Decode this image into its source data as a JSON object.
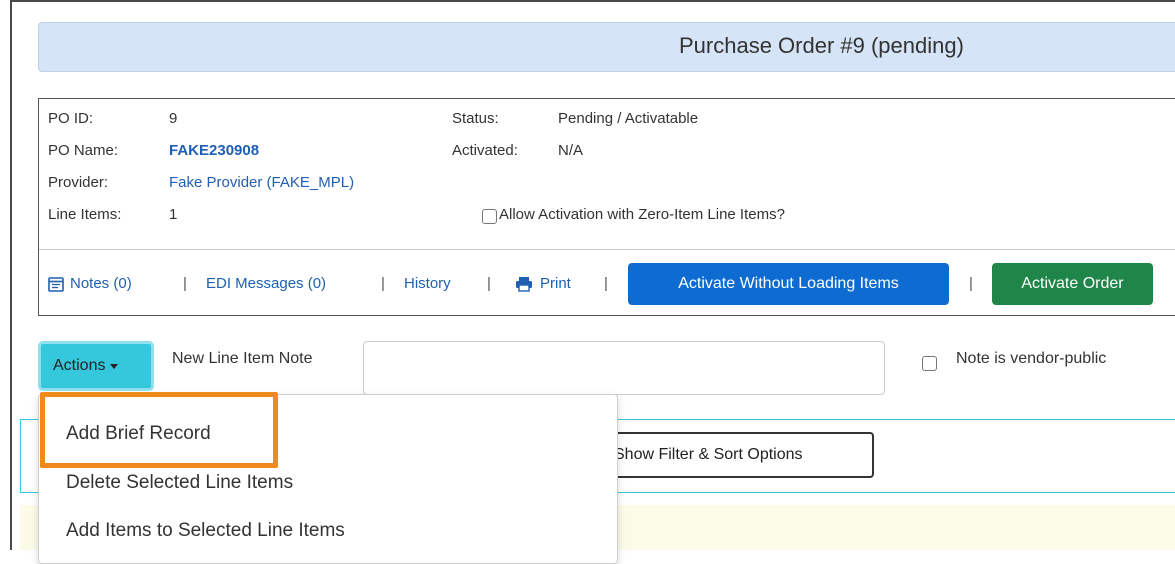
{
  "title": "Purchase Order #9 (pending)",
  "po": {
    "id_label": "PO ID:",
    "id_value": "9",
    "name_label": "PO Name:",
    "name_value": "FAKE230908",
    "provider_label": "Provider:",
    "provider_value": "Fake Provider (FAKE_MPL)",
    "line_items_label": "Line Items:",
    "line_items_value": "1",
    "status_label": "Status:",
    "status_value": "Pending / Activatable",
    "activated_label": "Activated:",
    "activated_value": "N/A",
    "zero_item_label": "Allow Activation with Zero-Item Line Items?"
  },
  "toolbar": {
    "notes": "Notes (0)",
    "edi": "EDI Messages (0)",
    "history": "History",
    "print": "Print",
    "sep": "|",
    "activate_without_loading": "Activate Without Loading Items",
    "activate_order": "Activate Order"
  },
  "actions": {
    "button_label": "Actions",
    "note_label": "New Line Item Note",
    "note_value": "",
    "vendor_public_label": "Note is vendor-public"
  },
  "dropdown_items": [
    "Add Brief Record",
    "Delete Selected Line Items",
    "Add Items to Selected Line Items"
  ],
  "filter_button": "Show Filter & Sort Options",
  "colors": {
    "title_bar": "#d5e4f6",
    "link": "#1f5fb4",
    "activate_without_loading": "#0d6bd1",
    "activate_order": "#1f8549",
    "actions_button": "#35c8dc",
    "highlight": "#f08a1c"
  },
  "icons": [
    "notes-icon",
    "print-icon",
    "caret-down-icon"
  ]
}
